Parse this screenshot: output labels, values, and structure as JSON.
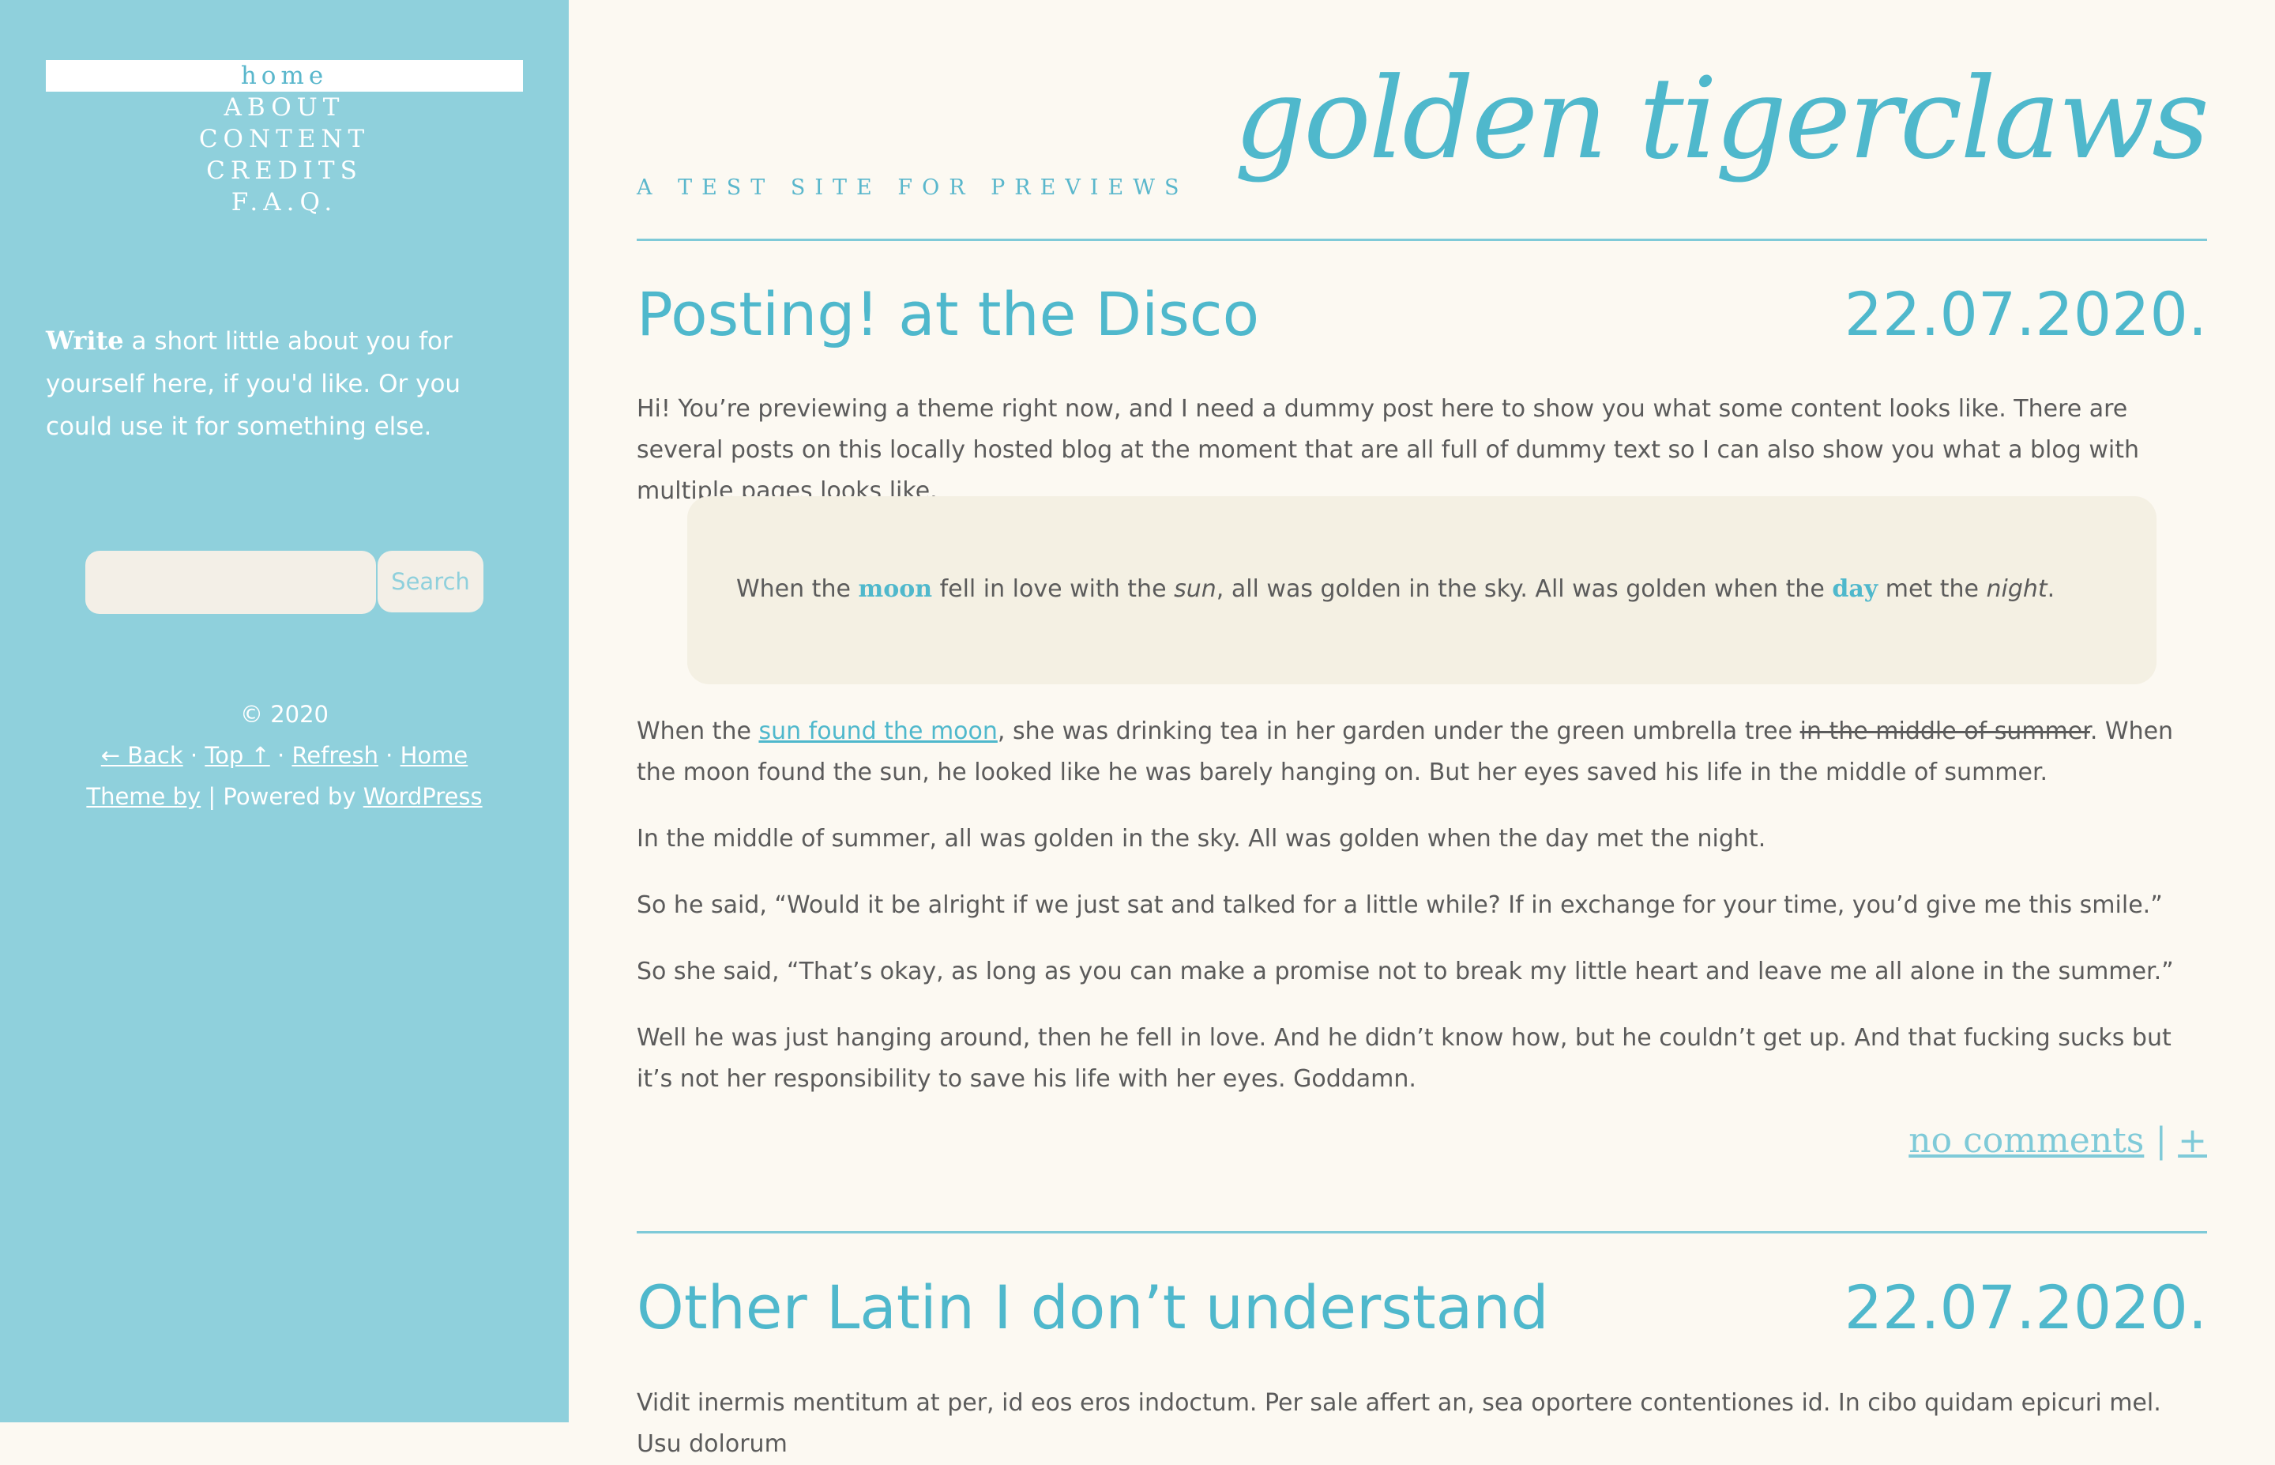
{
  "sidebar": {
    "nav": [
      {
        "label": "home",
        "active": true
      },
      {
        "label": "about",
        "active": false
      },
      {
        "label": "content",
        "active": false
      },
      {
        "label": "credits",
        "active": false
      },
      {
        "label": "f.a.q.",
        "active": false
      }
    ],
    "about_lead": "Write",
    "about_text": " a short little about you for yourself here, if you'd like. Or you could use it for something else.",
    "search": {
      "placeholder": "",
      "button_label": "Search"
    },
    "footer": {
      "copyright": "© 2020",
      "back": "← Back",
      "top": "Top ↑",
      "refresh": "Refresh",
      "home": "Home",
      "theme_by": "Theme by",
      "powered_by": "Powered by",
      "wordpress": "WordPress",
      "sep_dot": " · ",
      "sep_bar": " | "
    }
  },
  "site": {
    "title": "golden tigerclaws",
    "tagline": "A TEST SITE FOR PREVIEWS"
  },
  "posts": [
    {
      "title": "Posting! at the Disco",
      "date": "22.07.2020.",
      "intro": "Hi! You’re previewing a theme right now, and I need a dummy post here to show you what some content looks like. There are several posts on this locally hosted blog at the moment that are all full of dummy text so I can also show you what a blog with multiple pages looks like.",
      "quote": {
        "p1": "When the ",
        "hl1": "moon",
        "p2": " fell in love with the ",
        "em1": "sun",
        "p3": ", all was golden in the sky. All was golden when the ",
        "hl2": "day",
        "p4": " met the ",
        "em2": "night",
        "p5": "."
      },
      "para2": {
        "a": "When the ",
        "link": "sun found the moon",
        "b": ", she was drinking tea in her garden under the green umbrella tree ",
        "strike": "in the middle of summer",
        "c": ". When the moon found the sun, he looked like he was barely hanging on. But her eyes saved his life in the middle of summer."
      },
      "para3": "In the middle of summer, all was golden in the sky. All was golden when the day met the night.",
      "para4": "So he said, “Would it be alright if we just sat and talked for a little while? If in exchange for your time, you’d give me this smile.”",
      "para5": "So she said, “That’s okay, as long as you can make a promise not to break my little heart and leave me all alone in the summer.”",
      "para6": "Well he was just hanging around, then he fell in love. And he didn’t know how, but he couldn’t get up. And that fucking sucks but it’s not her responsibility to save his life with her eyes. Goddamn.",
      "comments": "no comments",
      "meta_sep": " | ",
      "add_icon": "+"
    },
    {
      "title": "Other Latin I don’t understand",
      "date": "22.07.2020.",
      "intro": "Vidit inermis mentitum at per, id eos eros indoctum. Per sale affert an, sea oportere contentiones id. In cibo quidam epicuri mel. Usu dolorum"
    }
  ]
}
